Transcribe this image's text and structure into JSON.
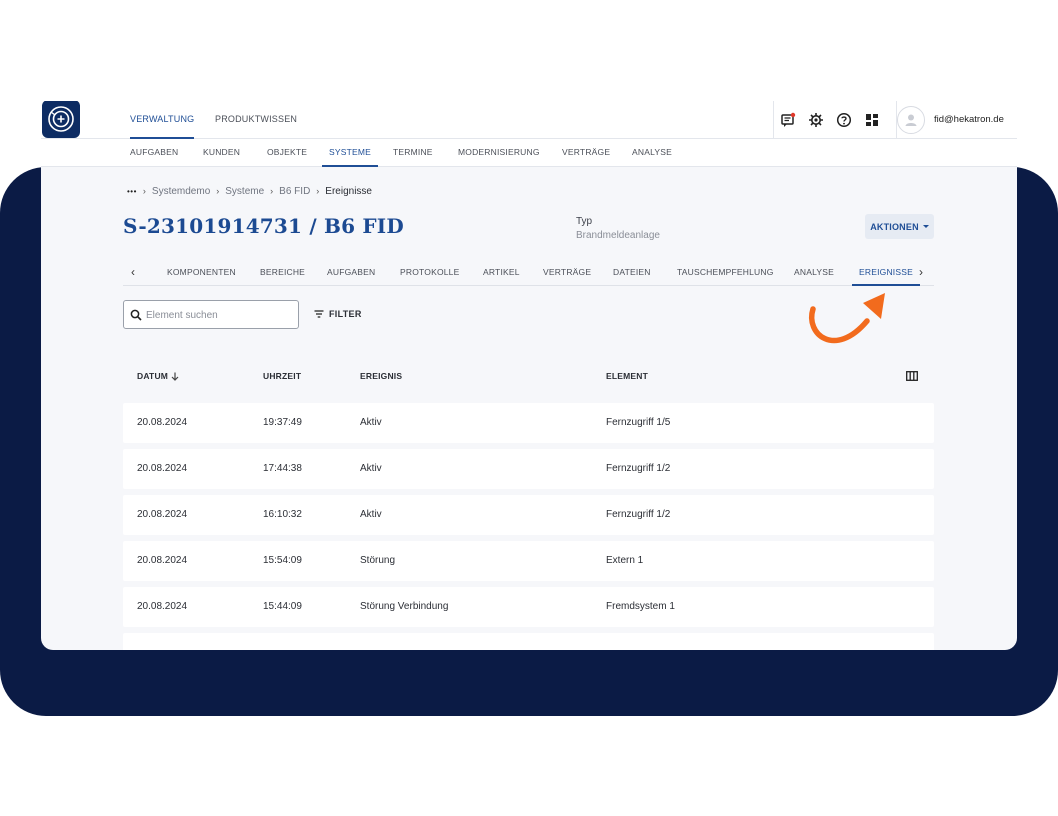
{
  "colors": {
    "navy": "#0b1b45",
    "primary": "#1f4e96",
    "accent_arrow": "#f26b1d"
  },
  "topbar": {
    "tabs": [
      {
        "label": "VERWALTUNG",
        "active": true
      },
      {
        "label": "PRODUKTWISSEN",
        "active": false
      }
    ],
    "icons": [
      "notification-icon",
      "gear-icon",
      "help-icon",
      "apps-grid-icon"
    ],
    "user_email": "fid@hekatron.de"
  },
  "subnav": {
    "tabs": [
      {
        "label": "AUFGABEN"
      },
      {
        "label": "KUNDEN"
      },
      {
        "label": "OBJEKTE"
      },
      {
        "label": "SYSTEME",
        "active": true
      },
      {
        "label": "TERMINE"
      },
      {
        "label": "MODERNISIERUNG"
      },
      {
        "label": "VERTRÄGE"
      },
      {
        "label": "ANALYSE"
      }
    ]
  },
  "breadcrumb": {
    "ellipsis": "•••",
    "items": [
      "Systemdemo",
      "Systeme",
      "B6 FID"
    ],
    "current": "Ereignisse"
  },
  "page": {
    "title": "S-23101914731 / B6 FID",
    "typ_label": "Typ",
    "typ_value": "Brandmeldeanlage",
    "actions_label": "AKTIONEN"
  },
  "detail_tabs": [
    {
      "label": "KOMPONENTEN"
    },
    {
      "label": "BEREICHE"
    },
    {
      "label": "AUFGABEN"
    },
    {
      "label": "PROTOKOLLE"
    },
    {
      "label": "ARTIKEL"
    },
    {
      "label": "VERTRÄGE"
    },
    {
      "label": "DATEIEN"
    },
    {
      "label": "TAUSCHEMPFEHLUNG"
    },
    {
      "label": "ANALYSE"
    },
    {
      "label": "EREIGNISSE",
      "active": true
    }
  ],
  "search": {
    "placeholder": "Element suchen",
    "value": ""
  },
  "filter_label": "FILTER",
  "table": {
    "columns": [
      "DATUM",
      "UHRZEIT",
      "EREIGNIS",
      "ELEMENT"
    ],
    "sort_column": "DATUM",
    "sort_direction": "desc",
    "rows": [
      {
        "datum": "20.08.2024",
        "uhrzeit": "19:37:49",
        "ereignis": "Aktiv",
        "element": "Fernzugriff 1/5"
      },
      {
        "datum": "20.08.2024",
        "uhrzeit": "17:44:38",
        "ereignis": "Aktiv",
        "element": "Fernzugriff 1/2"
      },
      {
        "datum": "20.08.2024",
        "uhrzeit": "16:10:32",
        "ereignis": "Aktiv",
        "element": "Fernzugriff 1/2"
      },
      {
        "datum": "20.08.2024",
        "uhrzeit": "15:54:09",
        "ereignis": "Störung",
        "element": "Extern 1"
      },
      {
        "datum": "20.08.2024",
        "uhrzeit": "15:44:09",
        "ereignis": "Störung Verbindung",
        "element": "Fremdsystem 1"
      }
    ]
  }
}
